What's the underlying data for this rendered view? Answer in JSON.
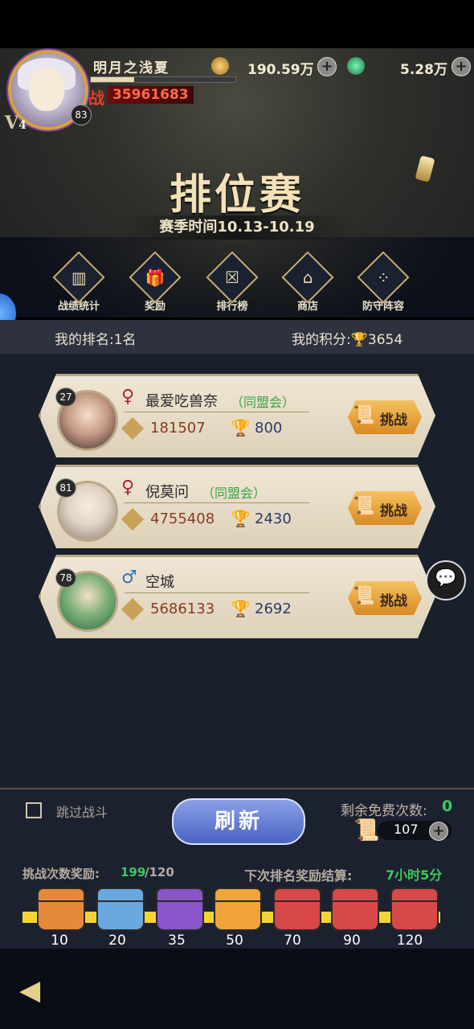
{
  "player": {
    "name": "明月之浅夏",
    "vip": "V",
    "vip_level": "4",
    "level": "83",
    "power_icon": "战",
    "power": "35961683",
    "exp_fraction": 0.3
  },
  "currency": {
    "coins": "190.59万",
    "gems": "5.28万",
    "plus": "+"
  },
  "banner": {
    "title": "排位赛",
    "season": "赛季时间10.13-10.19"
  },
  "menu": [
    {
      "label": "战绩统计",
      "icon": "bar-chart-icon"
    },
    {
      "label": "奖励",
      "icon": "gift-icon"
    },
    {
      "label": "排行榜",
      "icon": "leaderboard-icon"
    },
    {
      "label": "商店",
      "icon": "shop-icon"
    },
    {
      "label": "防守阵容",
      "icon": "formation-icon"
    }
  ],
  "rank": {
    "my_rank": "我的排名:1名",
    "my_score_label": "我的积分:",
    "my_score": "3654"
  },
  "opponents": [
    {
      "level": "27",
      "gender": "♀",
      "gender_color": "#b0242c",
      "name": "最爱吃兽奈",
      "guild": "（同盟会）",
      "power": "181507",
      "trophies": "800",
      "button": "挑战"
    },
    {
      "level": "81",
      "gender": "♀",
      "gender_color": "#b0242c",
      "name": "倪莫问",
      "guild": "（同盟会）",
      "power": "4755408",
      "trophies": "2430",
      "button": "挑战"
    },
    {
      "level": "78",
      "gender": "♂",
      "gender_color": "#2a74c6",
      "name": "空城",
      "guild": "",
      "power": "5686133",
      "trophies": "2692",
      "button": "挑战"
    }
  ],
  "bottom": {
    "skip_label": "跳过战斗",
    "refresh": "刷新",
    "free_label": "剩余免费次数:",
    "free_count": "0",
    "tickets": "107",
    "reward_label": "挑战次数奖励:",
    "reward_progress": "199",
    "reward_total": "/120",
    "next_label": "下次排名奖励结算:",
    "next_time": "7小时5分"
  },
  "chests": [
    {
      "count": "10",
      "color": "#e58a3a"
    },
    {
      "count": "20",
      "color": "#6aa8e0"
    },
    {
      "count": "35",
      "color": "#8a55c8"
    },
    {
      "count": "50",
      "color": "#f0a43a"
    },
    {
      "count": "70",
      "color": "#d94848"
    },
    {
      "count": "90",
      "color": "#d94848"
    },
    {
      "count": "120",
      "color": "#d94848"
    }
  ],
  "colors": {
    "accent_gold": "#f3e2b8",
    "green": "#3acb5a",
    "progress": "#f2d534"
  }
}
